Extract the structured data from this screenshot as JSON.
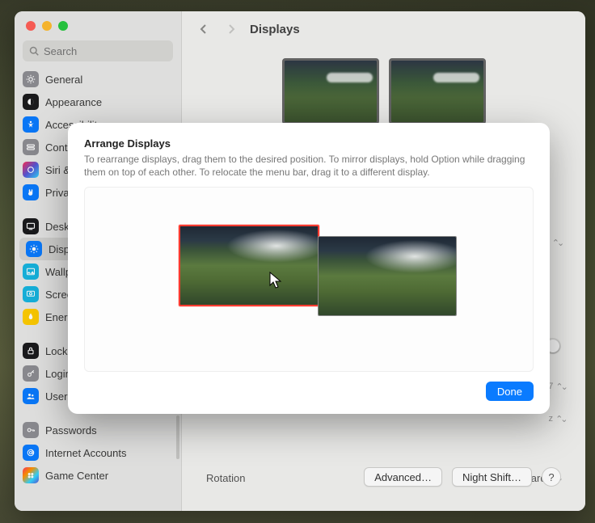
{
  "window": {
    "search_placeholder": "Search"
  },
  "header": {
    "title": "Displays"
  },
  "sidebar": {
    "items": [
      {
        "label": "General",
        "icon": "gear-icon",
        "color": "#8e8e93"
      },
      {
        "label": "Appearance",
        "icon": "appearance-icon",
        "color": "#1c1c1e"
      },
      {
        "label": "Accessibility",
        "icon": "accessibility-icon",
        "color": "#0a7bff"
      },
      {
        "label": "Control Center",
        "icon": "control-center-icon",
        "color": "#8e8e93"
      },
      {
        "label": "Siri & Spotlight",
        "icon": "siri-icon",
        "color": "#1c1c1e"
      },
      {
        "label": "Privacy & Security",
        "icon": "hand-icon",
        "color": "#0a7bff"
      },
      {
        "label": "Desktop & Dock",
        "icon": "desktop-icon",
        "color": "#1c1c1e"
      },
      {
        "label": "Displays",
        "icon": "displays-icon",
        "color": "#0a7bff",
        "selected": true
      },
      {
        "label": "Wallpaper",
        "icon": "wallpaper-icon",
        "color": "#17b6e0"
      },
      {
        "label": "Screen Saver",
        "icon": "screensaver-icon",
        "color": "#17b6e0"
      },
      {
        "label": "Energy Saver",
        "icon": "energy-icon",
        "color": "#ffcc00"
      },
      {
        "label": "Lock Screen",
        "icon": "lock-icon",
        "color": "#1c1c1e"
      },
      {
        "label": "Login Password",
        "icon": "key-icon",
        "color": "#8e8e93"
      },
      {
        "label": "Users & Groups",
        "icon": "users-icon",
        "color": "#0a7bff"
      },
      {
        "label": "Passwords",
        "icon": "passwords-icon",
        "color": "#8e8e93"
      },
      {
        "label": "Internet Accounts",
        "icon": "at-icon",
        "color": "#0a7bff"
      },
      {
        "label": "Game Center",
        "icon": "game-icon",
        "color": "#ff375f"
      }
    ]
  },
  "main": {
    "rotation_label": "Rotation",
    "rotation_value": "Standard",
    "advanced_label": "Advanced…",
    "nightshift_label": "Night Shift…",
    "help_label": "?"
  },
  "sheet": {
    "title": "Arrange Displays",
    "description": "To rearrange displays, drag them to the desired position. To mirror displays, hold Option while dragging them on top of each other. To relocate the menu bar, drag it to a different display.",
    "done_label": "Done"
  }
}
